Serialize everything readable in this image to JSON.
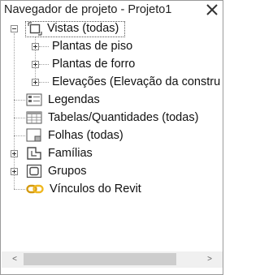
{
  "window": {
    "title": "Navegador de projeto - Projeto1",
    "close_glyph": "✕"
  },
  "tree": {
    "views": {
      "label": "Vistas (todas)",
      "icon": "views-icon",
      "expanded": true,
      "children": [
        {
          "label": "Plantas de piso"
        },
        {
          "label": "Plantas de forro"
        },
        {
          "label": "Elevações (Elevação da constru"
        }
      ]
    },
    "legends": {
      "label": "Legendas",
      "icon": "legend-icon"
    },
    "schedules": {
      "label": "Tabelas/Quantidades (todas)",
      "icon": "schedule-icon"
    },
    "sheets": {
      "label": "Folhas (todas)",
      "icon": "sheet-icon"
    },
    "families": {
      "label": "Famílias",
      "icon": "families-icon",
      "expanded": false
    },
    "groups": {
      "label": "Grupos",
      "icon": "groups-icon",
      "expanded": false
    },
    "links": {
      "label": "Vínculos do Revit",
      "icon": "revit-link-icon",
      "link_color": "#e0a010"
    }
  },
  "scrollbar": {
    "left_arrow": "<",
    "right_arrow": ">"
  }
}
